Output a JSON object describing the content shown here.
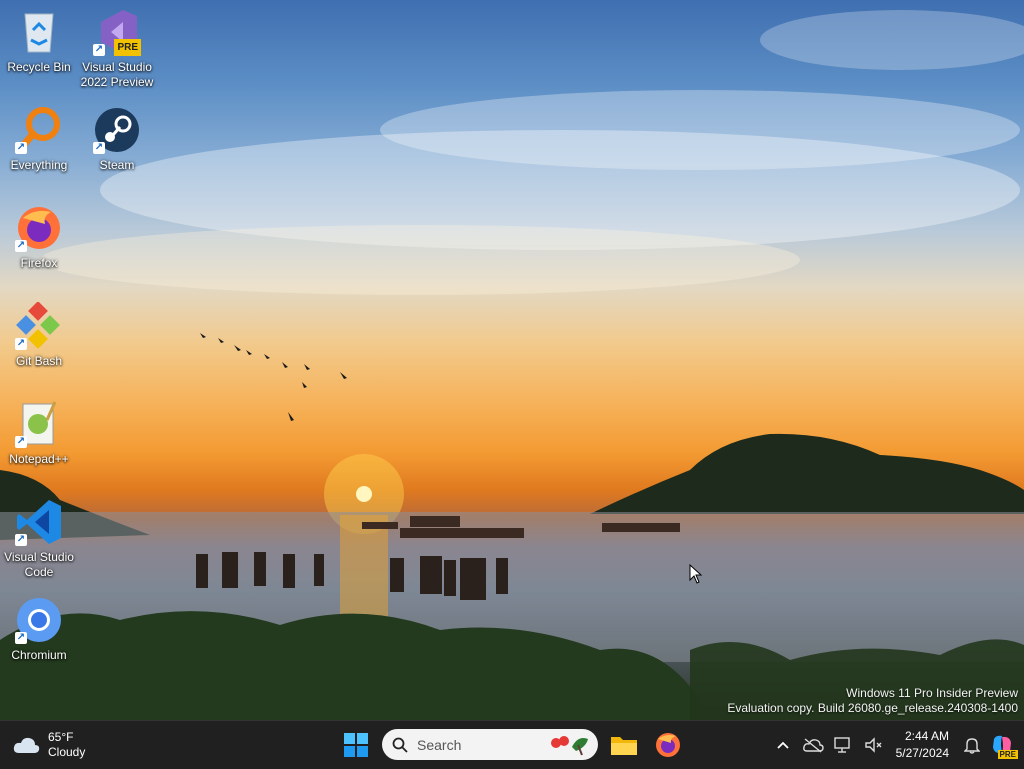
{
  "desktop": {
    "icons": [
      {
        "label": "Recycle Bin"
      },
      {
        "label": "Visual Studio 2022 Preview"
      },
      {
        "label": "Everything"
      },
      {
        "label": "Steam"
      },
      {
        "label": "Firefox"
      },
      {
        "label": "Git Bash"
      },
      {
        "label": "Notepad++"
      },
      {
        "label": "Visual Studio Code"
      },
      {
        "label": "Chromium"
      }
    ],
    "vs_badge": "PRE"
  },
  "watermark": {
    "line1": "Windows 11 Pro Insider Preview",
    "line2": "Evaluation copy. Build 26080.ge_release.240308-1400"
  },
  "taskbar": {
    "weather": {
      "temp": "65°F",
      "condition": "Cloudy",
      "icon": "cloud-icon"
    },
    "start_icon": "windows-logo-icon",
    "search": {
      "placeholder": "Search"
    },
    "pinned": [
      {
        "name": "File Explorer",
        "icon": "folder-icon"
      },
      {
        "name": "Firefox",
        "icon": "firefox-icon"
      }
    ],
    "clock": {
      "time": "2:44 AM",
      "date": "5/27/2024"
    },
    "copilot_badge": "PRE"
  }
}
